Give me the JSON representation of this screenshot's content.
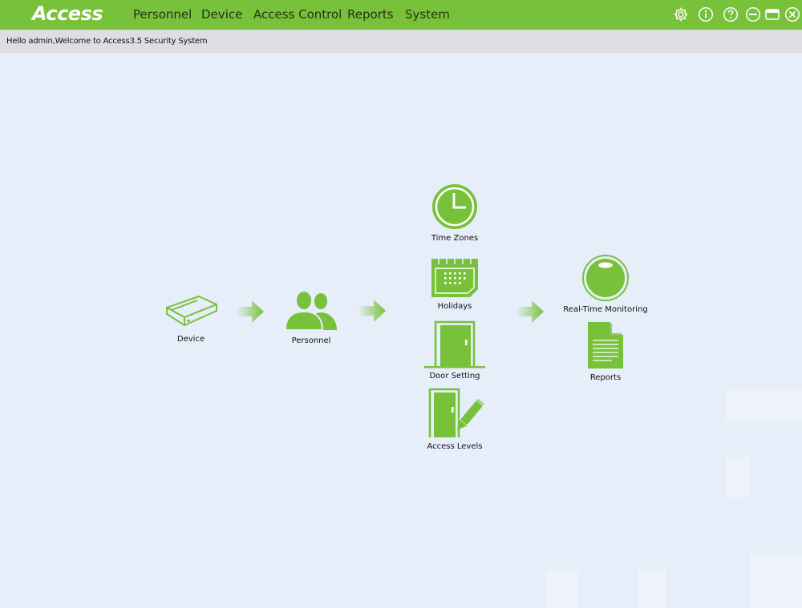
{
  "app": {
    "logo": "Access",
    "accent_color": "#78c13a"
  },
  "menu": {
    "items": [
      "Personnel",
      "Device",
      "Access Control",
      "Reports",
      "System"
    ]
  },
  "window_controls": [
    "gear-icon",
    "info-icon",
    "help-icon",
    "minimize-icon",
    "restore-icon",
    "close-icon"
  ],
  "welcome": {
    "text": "Hello admin,Welcome to Access3.5 Security System"
  },
  "workflow": {
    "device": "Device",
    "personnel": "Personnel",
    "time_zones": "Time Zones",
    "holidays": "Holidays",
    "door_setting": "Door Setting",
    "access_levels": "Access Levels",
    "real_time_monitoring": "Real-Time Monitoring",
    "reports": "Reports"
  }
}
